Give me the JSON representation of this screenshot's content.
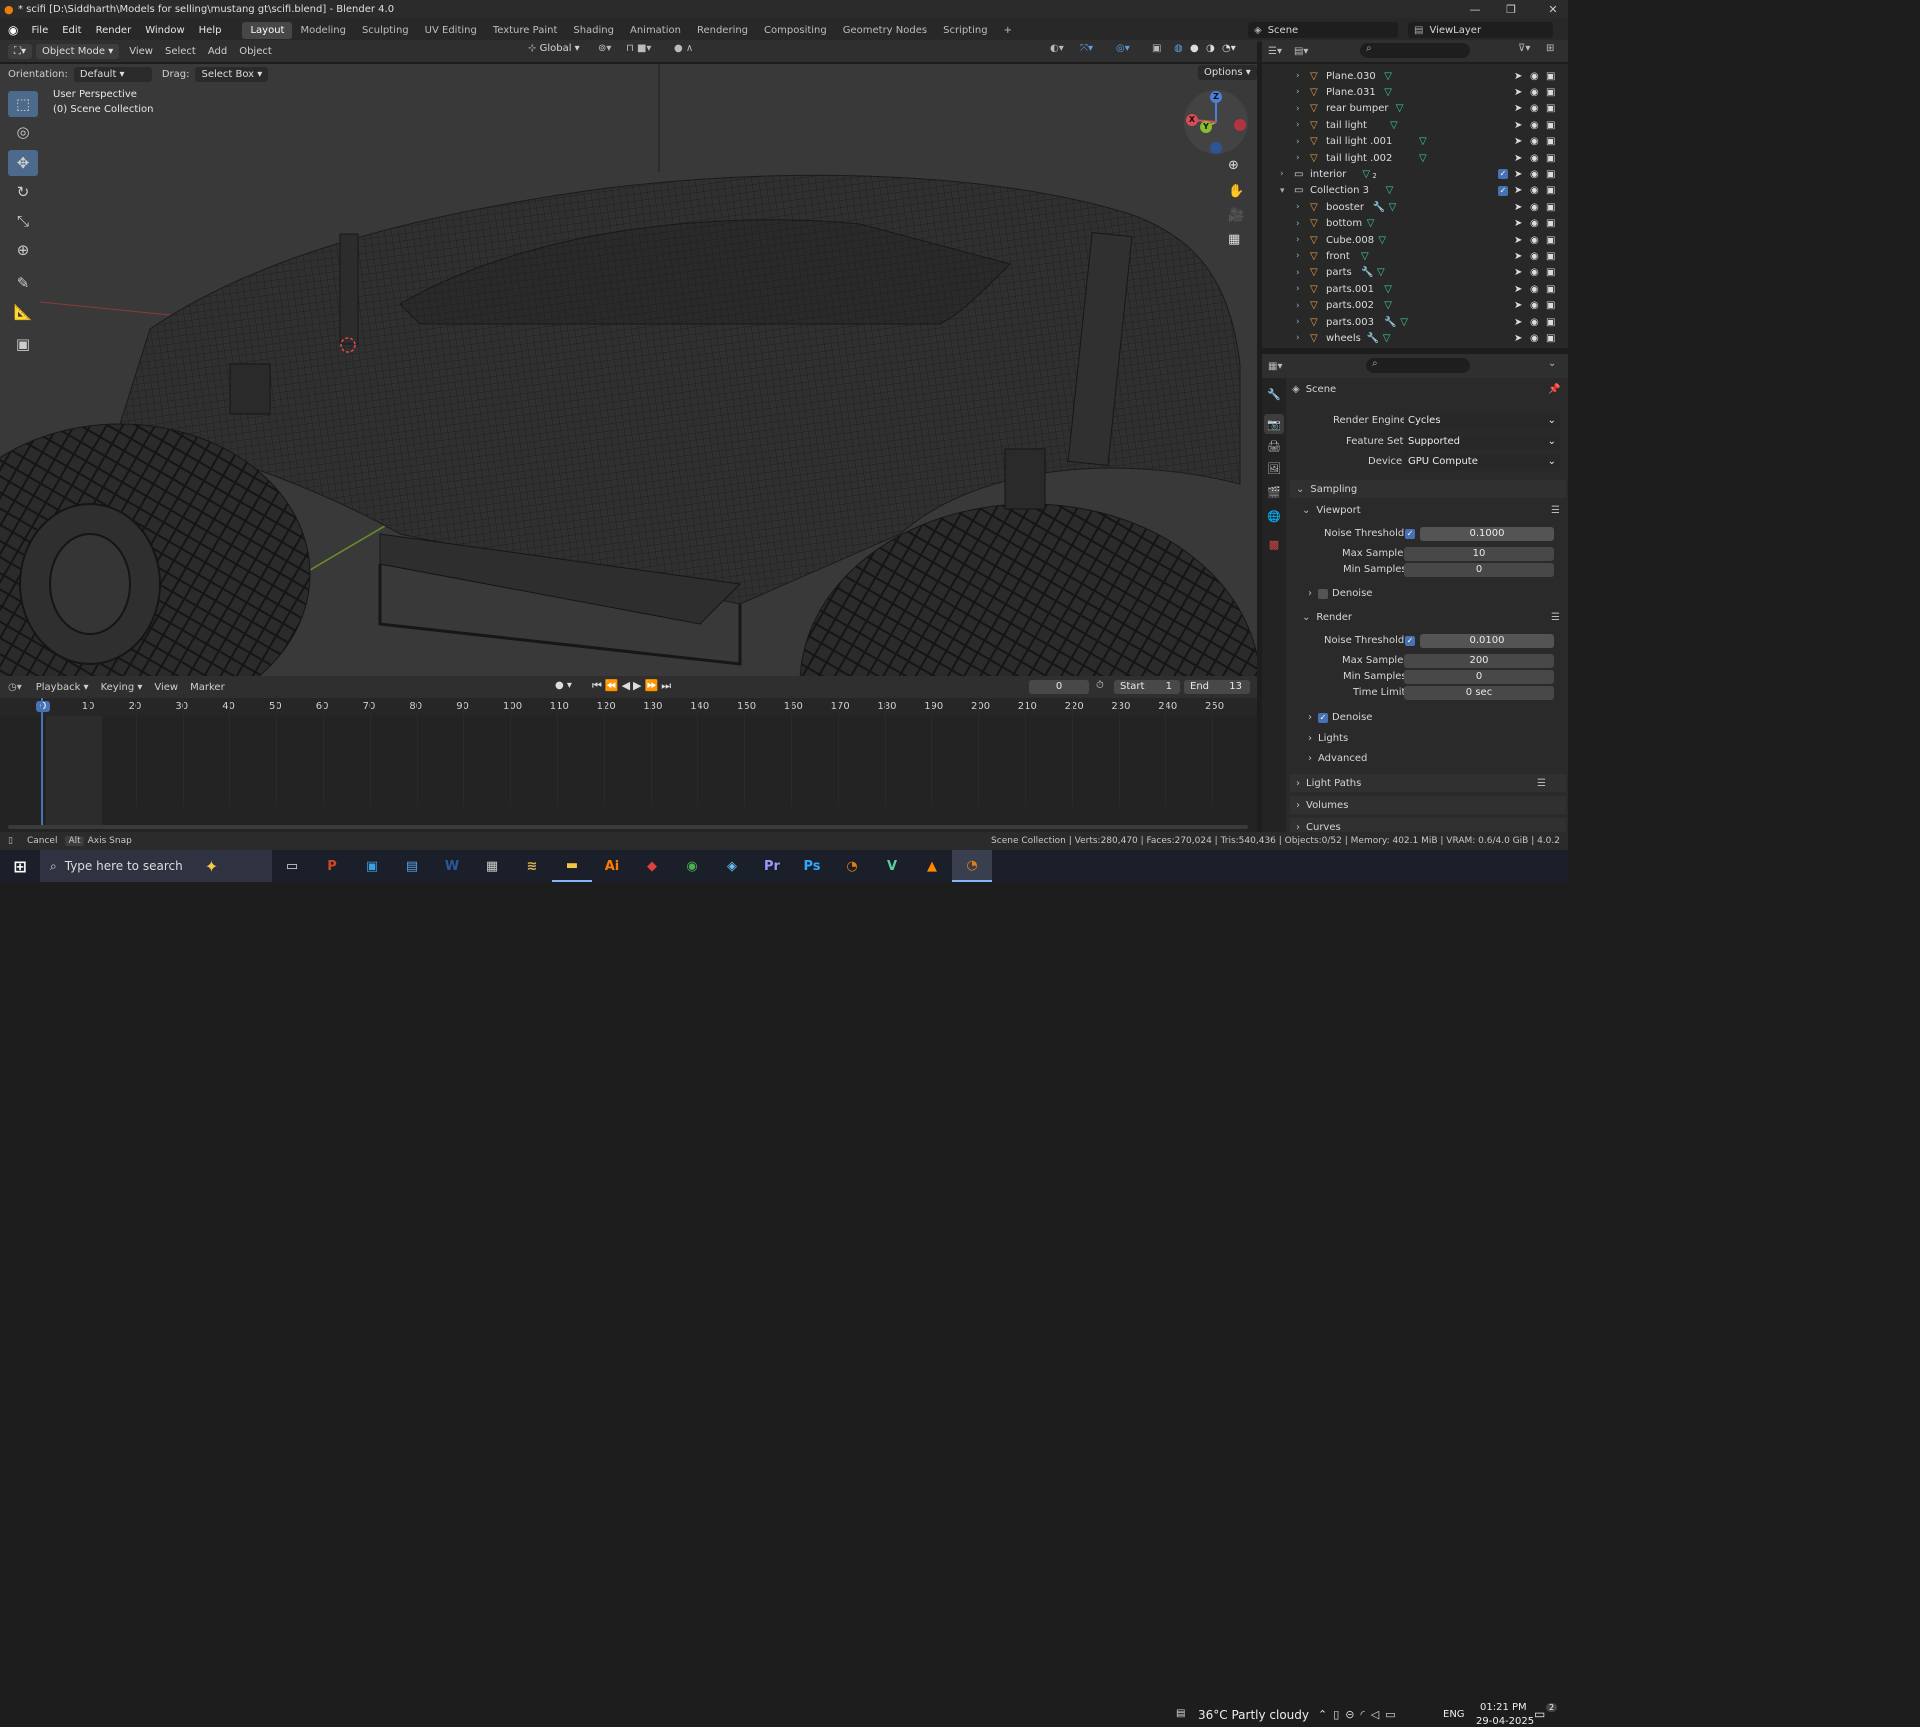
{
  "window": {
    "title": "* scifi [D:\\Siddharth\\Models for selling\\mustang gt\\scifi.blend] - Blender 4.0"
  },
  "menu": [
    "File",
    "Edit",
    "Render",
    "Window",
    "Help"
  ],
  "workspaces": [
    "Layout",
    "Modeling",
    "Sculpting",
    "UV Editing",
    "Texture Paint",
    "Shading",
    "Animation",
    "Rendering",
    "Compositing",
    "Geometry Nodes",
    "Scripting"
  ],
  "top_right": {
    "scene": "Scene",
    "view_layer": "ViewLayer"
  },
  "viewport_header": {
    "mode": "Object Mode",
    "menus": [
      "View",
      "Select",
      "Add",
      "Object"
    ],
    "transform": "Global",
    "options": "Options"
  },
  "tool_settings": {
    "orientation_label": "Orientation:",
    "orientation": "Default",
    "drag_label": "Drag:",
    "drag": "Select Box"
  },
  "viewport": {
    "perspective": "User Perspective",
    "collection": "(0) Scene Collection",
    "gizmo": {
      "z": "Z",
      "y": "Y",
      "x": "X"
    }
  },
  "outliner": {
    "rows": [
      {
        "name": "Plane.030",
        "indent": 2
      },
      {
        "name": "Plane.031",
        "indent": 2
      },
      {
        "name": "rear bumper",
        "indent": 2
      },
      {
        "name": "tail light",
        "indent": 2
      },
      {
        "name": "tail light .001",
        "indent": 2
      },
      {
        "name": "tail light .002",
        "indent": 2
      },
      {
        "name": "interior",
        "indent": 1,
        "collection": true,
        "badge": "2"
      },
      {
        "name": "Collection 3",
        "indent": 1,
        "collection": true,
        "expanded": true
      },
      {
        "name": "booster",
        "indent": 2,
        "modifier": true
      },
      {
        "name": "bottom",
        "indent": 2
      },
      {
        "name": "Cube.008",
        "indent": 2
      },
      {
        "name": "front",
        "indent": 2
      },
      {
        "name": "parts",
        "indent": 2,
        "modifier": true
      },
      {
        "name": "parts.001",
        "indent": 2
      },
      {
        "name": "parts.002",
        "indent": 2
      },
      {
        "name": "parts.003",
        "indent": 2,
        "modifier": true
      },
      {
        "name": "wheels",
        "indent": 2,
        "modifier": true
      }
    ]
  },
  "properties": {
    "scene": "Scene",
    "render_engine_label": "Render Engine",
    "render_engine": "Cycles",
    "feature_set_label": "Feature Set",
    "feature_set": "Supported",
    "device_label": "Device",
    "device": "GPU Compute",
    "sampling": "Sampling",
    "viewport": {
      "title": "Viewport",
      "noise_threshold_label": "Noise Threshold",
      "noise_threshold": "0.1000",
      "max_samples_label": "Max Samples",
      "max_samples": "10",
      "min_samples_label": "Min Samples",
      "min_samples": "0",
      "denoise": "Denoise"
    },
    "render": {
      "title": "Render",
      "noise_threshold_label": "Noise Threshold",
      "noise_threshold": "0.0100",
      "max_samples_label": "Max Samples",
      "max_samples": "200",
      "min_samples_label": "Min Samples",
      "min_samples": "0",
      "time_limit_label": "Time Limit",
      "time_limit": "0 sec",
      "denoise": "Denoise"
    },
    "lights": "Lights",
    "advanced": "Advanced",
    "light_paths": "Light Paths",
    "volumes": "Volumes",
    "curves": "Curves"
  },
  "timeline": {
    "menus": [
      "Playback",
      "Keying",
      "View",
      "Marker"
    ],
    "current_frame": "0",
    "start_label": "Start",
    "start": "1",
    "end_label": "End",
    "end": "13",
    "ticks": [
      "0",
      "10",
      "20",
      "30",
      "40",
      "50",
      "60",
      "70",
      "80",
      "90",
      "100",
      "110",
      "120",
      "130",
      "140",
      "150",
      "160",
      "170",
      "180",
      "190",
      "200",
      "210",
      "220",
      "230",
      "240",
      "250"
    ]
  },
  "statusbar": {
    "cancel": "Cancel",
    "alt": "Alt",
    "axis_snap": "Axis Snap",
    "stats": "Scene Collection | Verts:280,470 | Faces:270,024 | Tris:540,436 | Objects:0/52 | Memory: 402.1 MiB | VRAM: 0.6/4.0 GiB | 4.0.2"
  },
  "taskbar": {
    "search": "Type here to search",
    "weather": "36°C  Partly cloudy",
    "lang": "ENG",
    "time": "01:21 PM",
    "date": "29-04-2025",
    "notif": "2"
  }
}
